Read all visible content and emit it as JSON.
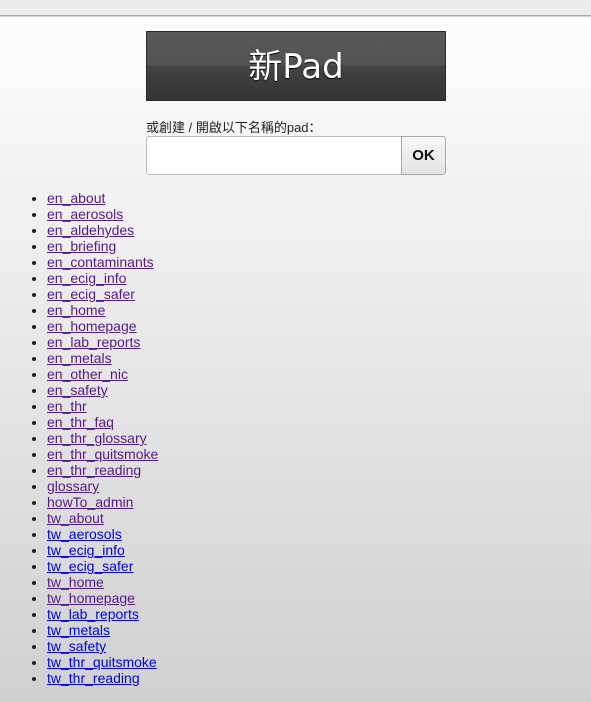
{
  "new_pad_button": {
    "label": "新Pad"
  },
  "open_form": {
    "label": "或創建 / 開啟以下名稱的pad：",
    "input_value": "",
    "input_placeholder": "",
    "ok_label": "OK"
  },
  "colors": {
    "visited_link": "#551a8b",
    "unvisited_link": "#0000ee",
    "button_bg": "#444444"
  },
  "pads": [
    {
      "name": "en_about",
      "visited": true
    },
    {
      "name": "en_aerosols",
      "visited": true
    },
    {
      "name": "en_aldehydes",
      "visited": true
    },
    {
      "name": "en_briefing",
      "visited": true
    },
    {
      "name": "en_contaminants",
      "visited": true
    },
    {
      "name": "en_ecig_info",
      "visited": true
    },
    {
      "name": "en_ecig_safer",
      "visited": true
    },
    {
      "name": "en_home",
      "visited": true
    },
    {
      "name": "en_homepage",
      "visited": true
    },
    {
      "name": "en_lab_reports",
      "visited": true
    },
    {
      "name": "en_metals",
      "visited": true
    },
    {
      "name": "en_other_nic",
      "visited": true
    },
    {
      "name": "en_safety",
      "visited": true
    },
    {
      "name": "en_thr",
      "visited": true
    },
    {
      "name": "en_thr_faq",
      "visited": true
    },
    {
      "name": "en_thr_glossary",
      "visited": true
    },
    {
      "name": "en_thr_quitsmoke",
      "visited": true
    },
    {
      "name": "en_thr_reading",
      "visited": true
    },
    {
      "name": "glossary",
      "visited": true
    },
    {
      "name": "howTo_admin",
      "visited": true
    },
    {
      "name": "tw_about",
      "visited": true
    },
    {
      "name": "tw_aerosols",
      "visited": false
    },
    {
      "name": "tw_ecig_info",
      "visited": false
    },
    {
      "name": "tw_ecig_safer",
      "visited": false
    },
    {
      "name": "tw_home",
      "visited": true
    },
    {
      "name": "tw_homepage",
      "visited": true
    },
    {
      "name": "tw_lab_reports",
      "visited": false
    },
    {
      "name": "tw_metals",
      "visited": false
    },
    {
      "name": "tw_safety",
      "visited": false
    },
    {
      "name": "tw_thr_quitsmoke",
      "visited": false
    },
    {
      "name": "tw_thr_reading",
      "visited": false
    }
  ]
}
